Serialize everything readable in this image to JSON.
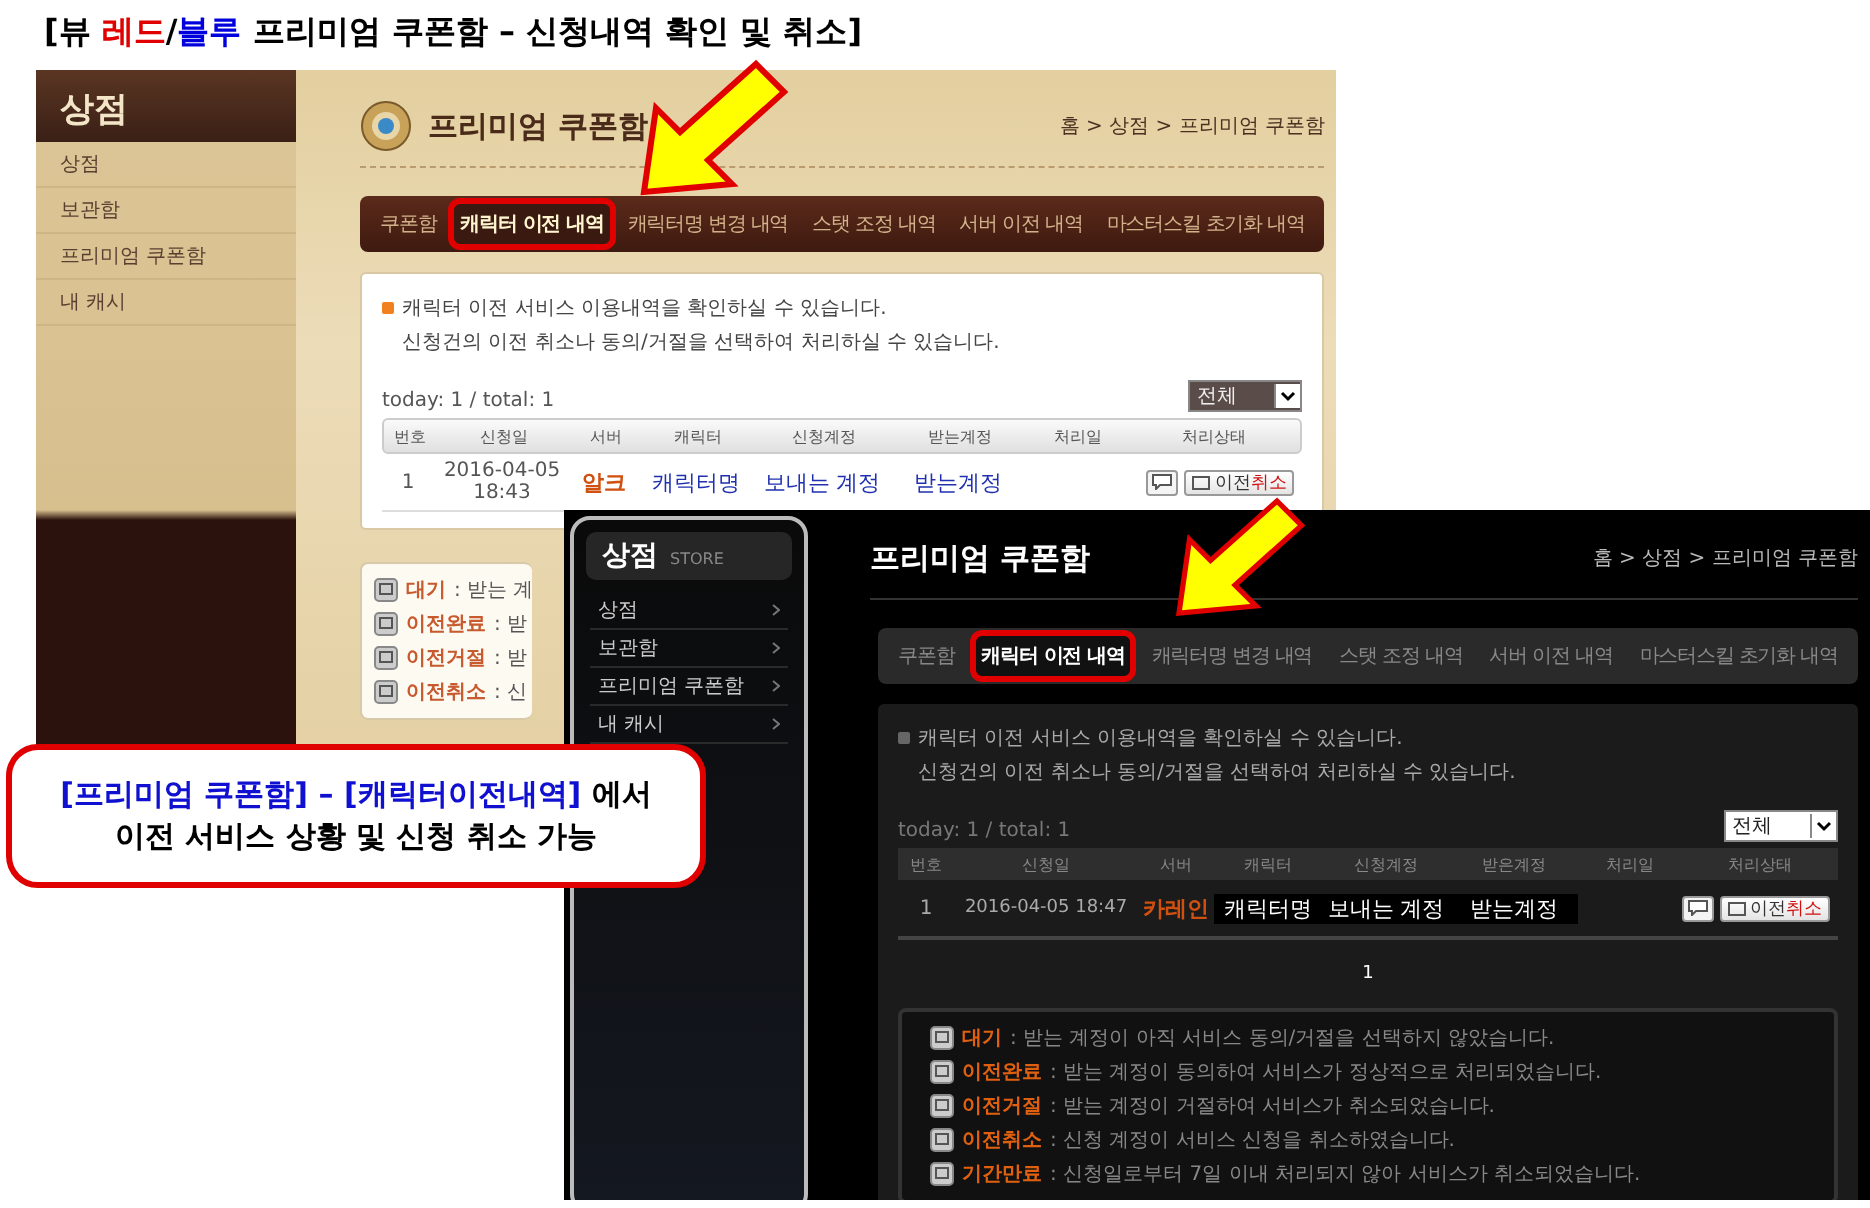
{
  "heading": {
    "parts": [
      {
        "text": "[뷰 ",
        "color": "#000000"
      },
      {
        "text": "레드",
        "color": "#e00000"
      },
      {
        "text": "/",
        "color": "#000000"
      },
      {
        "text": "블루",
        "color": "#0000dd"
      },
      {
        "text": " 프리미엄 쿠폰함 – 신청내역 확인 및 취소]",
        "color": "#000000"
      }
    ]
  },
  "screens": [
    {
      "kind": "red",
      "sidebar": {
        "title": "상점",
        "items": [
          "상점",
          "보관함",
          "프리미엄 쿠폰함",
          "내 캐시"
        ]
      },
      "page_title": "프리미엄 쿠폰함",
      "breadcrumb": "홈 > 상점 > 프리미엄 쿠폰함",
      "tabs": [
        {
          "label": "쿠폰함",
          "selected": false
        },
        {
          "label": "캐릭터 이전 내역",
          "selected": true
        },
        {
          "label": "캐릭터명 변경 내역",
          "selected": false
        },
        {
          "label": "스탯 조정 내역",
          "selected": false
        },
        {
          "label": "서버 이전 내역",
          "selected": false
        },
        {
          "label": "마스터스킬 초기화 내역",
          "selected": false
        }
      ],
      "notice": [
        "캐릭터 이전 서비스 이용내역을 확인하실 수 있습니다.",
        "신청건의 이전 취소나 동의/거절을 선택하여 처리하실 수 있습니다."
      ],
      "count": "today: 1 / total: 1",
      "filter": "전체",
      "columns": [
        "번호",
        "신청일",
        "서버",
        "캐릭터",
        "신청계정",
        "받는계정",
        "처리일",
        "처리상태"
      ],
      "rows": [
        {
          "number": "1",
          "date": "2016-04-05 18:43",
          "server": "알크",
          "character": "캐릭터명",
          "sender": "보내는 계정",
          "receiver": "받는계정",
          "cancel_label": "이전",
          "cancel_accent": "취소"
        }
      ],
      "legend": [
        {
          "label": "대기",
          "text": ": 받는 계"
        },
        {
          "label": "이전완료",
          "text": ": 받"
        },
        {
          "label": "이전거절",
          "text": ": 받"
        },
        {
          "label": "이전취소",
          "text": ": 신"
        }
      ]
    },
    {
      "kind": "blue",
      "sidebar": {
        "title": "상점",
        "subtitle": "STORE",
        "items": [
          "상점",
          "보관함",
          "프리미엄 쿠폰함",
          "내 캐시"
        ]
      },
      "page_title": "프리미엄 쿠폰함",
      "breadcrumb": "홈 > 상점 > 프리미엄 쿠폰함",
      "tabs": [
        {
          "label": "쿠폰함",
          "selected": false
        },
        {
          "label": "캐릭터 이전 내역",
          "selected": true
        },
        {
          "label": "캐릭터명 변경 내역",
          "selected": false
        },
        {
          "label": "스탯 조정 내역",
          "selected": false
        },
        {
          "label": "서버 이전 내역",
          "selected": false
        },
        {
          "label": "마스터스킬 초기화 내역",
          "selected": false
        }
      ],
      "notice": [
        "캐릭터 이전 서비스 이용내역을 확인하실 수 있습니다.",
        "신청건의 이전 취소나 동의/거절을 선택하여 처리하실 수 있습니다."
      ],
      "count": "today: 1 / total: 1",
      "filter": "전체",
      "columns": [
        "번호",
        "신청일",
        "서버",
        "캐릭터",
        "신청계정",
        "받은계정",
        "처리일",
        "처리상태"
      ],
      "rows": [
        {
          "number": "1",
          "date": "2016-04-05 18:47",
          "server": "카레인",
          "character": "캐릭터명",
          "sender": "보내는 계정",
          "receiver": "받는계정",
          "cancel_label": "이전",
          "cancel_accent": "취소"
        }
      ],
      "pager": "1",
      "legend": [
        {
          "label": "대기",
          "text": ": 받는 계정이 아직 서비스 동의/거절을 선택하지 않았습니다."
        },
        {
          "label": "이전완료",
          "text": ": 받는 계정이 동의하여 서비스가 정상적으로 처리되었습니다."
        },
        {
          "label": "이전거절",
          "text": ": 받는 계정이 거절하여 서비스가 취소되었습니다."
        },
        {
          "label": "이전취소",
          "text": ": 신청 계정이 서비스 신청을 취소하였습니다."
        },
        {
          "label": "기간만료",
          "text": ": 신청일로부터 7일 이내 처리되지 않아 서비스가 취소되었습니다."
        }
      ]
    }
  ],
  "callout": {
    "lines": [
      [
        {
          "text": "[프리미엄 쿠폰함] – [캐릭터이전내역]",
          "color": "#1010d0"
        },
        {
          "text": " 에서",
          "color": "#000000"
        }
      ],
      [
        {
          "text": "이전 서비스 상황 및 신청 취소 가능",
          "color": "#000000"
        }
      ]
    ]
  }
}
